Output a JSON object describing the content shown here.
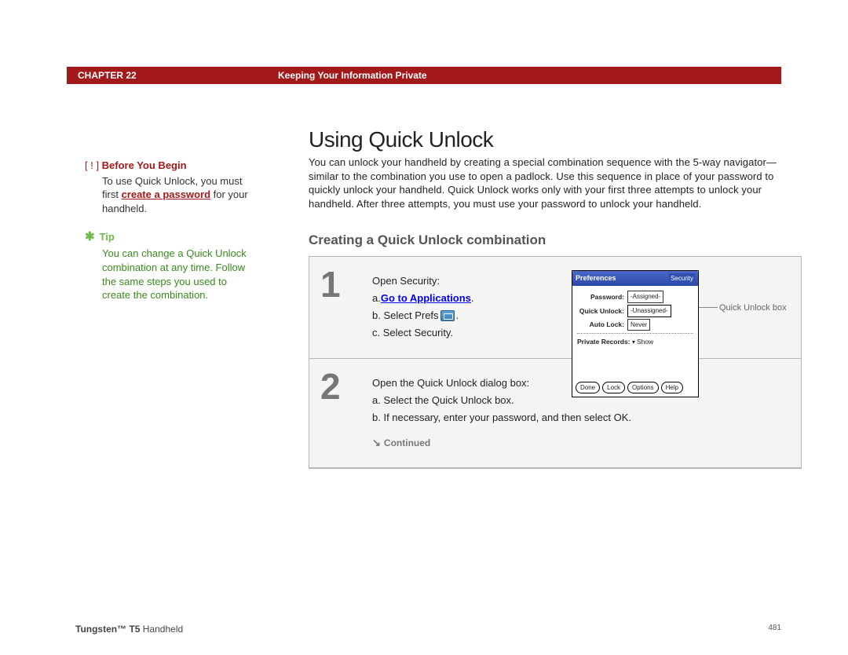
{
  "header": {
    "chapter": "CHAPTER 22",
    "section_title": "Keeping Your Information Private"
  },
  "page_title": "Using Quick Unlock",
  "intro": "You can unlock your handheld by creating a special combination sequence with the 5-way navigator—similar to the combination you use to open a padlock. Use this sequence in place of your password to quickly unlock your handheld. Quick Unlock works only with your first three attempts to unlock your handheld. After three attempts, you must use your password to unlock your handheld.",
  "subheading": "Creating a Quick Unlock combination",
  "steps": [
    {
      "num": "1",
      "lead": "Open Security:",
      "items": {
        "a_prefix": "a.  ",
        "a_link": "Go to Applications",
        "a_suffix": ".",
        "b_prefix": "b.  Select Prefs ",
        "b_suffix": ".",
        "c": "c.  Select Security."
      }
    },
    {
      "num": "2",
      "lead": "Open the Quick Unlock dialog box:",
      "items": {
        "a": "a.  Select the Quick Unlock box.",
        "b": "b.  If necessary, enter your password, and then select OK."
      }
    }
  ],
  "continued": "Continued",
  "palm": {
    "title_left": "Preferences",
    "title_right": "Security",
    "rows": {
      "password_label": "Password:",
      "password_val": "-Assigned-",
      "ql_label": "Quick Unlock:",
      "ql_val": "-Unassigned-",
      "al_label": "Auto Lock:",
      "al_val": "Never"
    },
    "private": "Private Records: ",
    "private_val": "Show",
    "buttons": [
      "Done",
      "Lock",
      "Options",
      "Help"
    ],
    "callout": "Quick Unlock box"
  },
  "sidebar": {
    "before_marker": "[ ! ] ",
    "before_head": "Before You Begin",
    "before_body_1": "To use Quick Unlock, you must first ",
    "before_link": "create a password",
    "before_body_2": " for your handheld.",
    "tip_head": "Tip",
    "tip_body": "You can change a Quick Unlock combination at any time. Follow the same steps you used to create the combination."
  },
  "footer": {
    "product_bold": "Tungsten™ T5",
    "product_rest": " Handheld",
    "page": "481"
  }
}
